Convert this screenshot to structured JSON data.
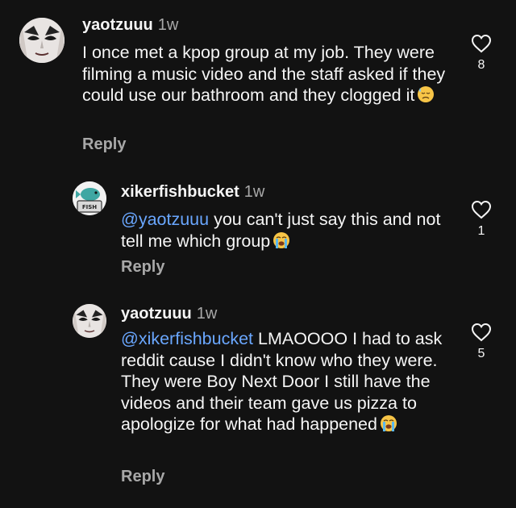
{
  "comments": [
    {
      "username": "yaotzuuu",
      "time": "1w",
      "text": "I once met a kpop group at my job. They were filming a music video and the staff asked if they could use our bathroom and they clogged it",
      "emoji": "downcast-sweat-emoji",
      "reply_label": "Reply",
      "likes": "8"
    },
    {
      "username": "xikerfishbucket",
      "time": "1w",
      "mention": "@yaotzuuu",
      "text": " you can't just say this and not tell me which group",
      "emoji": "loudly-crying-emoji",
      "reply_label": "Reply",
      "likes": "1"
    },
    {
      "username": "yaotzuuu",
      "time": "1w",
      "mention": "@xikerfishbucket",
      "text": " LMAOOOO I had to ask reddit cause I didn't know who they were. They were Boy Next Door  I still have the videos and their team gave us pizza to apologize for what had happened",
      "emoji": "loudly-crying-emoji",
      "reply_label": "Reply",
      "likes": "5"
    }
  ],
  "colors": {
    "background": "#121212",
    "mention": "#6aa7ff",
    "secondary_text": "#a8a8a8"
  }
}
